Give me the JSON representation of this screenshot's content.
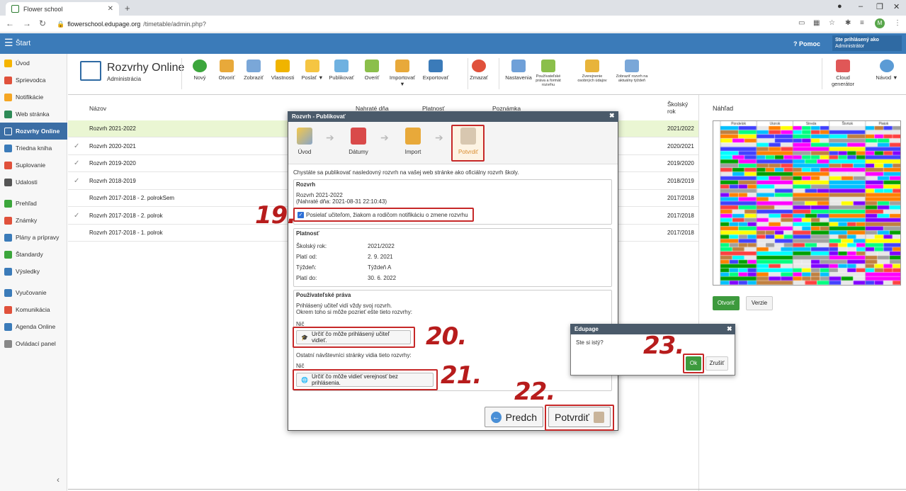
{
  "browser": {
    "tab_title": "Flower school",
    "url_domain": "flowerschool.edupage.org",
    "url_path": "/timetable/admin.php?",
    "avatar_letter": "M"
  },
  "appbar": {
    "start_label": "Štart",
    "help_label": "Pomoc",
    "login_line1": "Ste prihlásený ako",
    "login_line2": "Administrátor"
  },
  "sidebar": {
    "items": [
      {
        "label": "Úvod",
        "color": "#f5b400"
      },
      {
        "label": "Sprievodca",
        "color": "#e0513b"
      },
      {
        "label": "Notifikácie",
        "color": "#f5a623"
      },
      {
        "label": "Web stránka",
        "color": "#2e8b57"
      },
      {
        "label": "Rozvrhy Online",
        "color": "#ffffff"
      },
      {
        "label": "Triedna kniha",
        "color": "#3b7bb9"
      },
      {
        "label": "Suplovanie",
        "color": "#e0513b"
      },
      {
        "label": "Udalosti",
        "color": "#555555"
      },
      {
        "label": "Prehľad",
        "color": "#3ca63c"
      },
      {
        "label": "Známky",
        "color": "#e0513b"
      },
      {
        "label": "Plány a prípravy",
        "color": "#3b7bb9"
      },
      {
        "label": "Štandardy",
        "color": "#3ca63c"
      },
      {
        "label": "Výsledky",
        "color": "#3b7bb9"
      },
      {
        "label": "Vyučovanie",
        "color": "#3b7bb9"
      },
      {
        "label": "Komunikácia",
        "color": "#e0513b"
      },
      {
        "label": "Agenda Online",
        "color": "#3b7bb9"
      },
      {
        "label": "Ovládací panel",
        "color": "#888888"
      }
    ]
  },
  "toolbar": {
    "title": "Rozvrhy Online",
    "subtitle": "Administrácia",
    "buttons": [
      {
        "label": "Nový",
        "color": "#3ca63c"
      },
      {
        "label": "Otvoriť",
        "color": "#e8a93a"
      },
      {
        "label": "Zobraziť",
        "color": "#7aa7d8"
      },
      {
        "label": "Vlastnosti",
        "color": "#f0b400"
      },
      {
        "label": "Poslať ▼",
        "color": "#f5c542"
      },
      {
        "label": "Publikovať",
        "color": "#6fb1e0"
      },
      {
        "label": "Overiť",
        "color": "#8bbf4b"
      },
      {
        "label": "Importovať ▼",
        "color": "#e8a93a"
      },
      {
        "label": "Exportovať",
        "color": "#3b7bb9"
      },
      {
        "label": "Zmazať",
        "color": "#e0513b"
      },
      {
        "label": "Nastavenia",
        "color": "#6fa0d8"
      },
      {
        "label": "Používateľské práva a formát rozvrhu",
        "color": "#8bbf4b"
      },
      {
        "label": "Zverejnenie osobných údajov",
        "color": "#e8b43a"
      },
      {
        "label": "Zobraziť rozvrh na aktuálny týždeň",
        "color": "#7aa7d8"
      },
      {
        "label": "Cloud generátor",
        "color": "#e05757"
      },
      {
        "label": "Návod ▼",
        "color": "#5b9bd5"
      }
    ]
  },
  "table": {
    "headers": {
      "name": "Názov",
      "uploaded": "Nahraté dňa",
      "validity": "Platnosť",
      "note": "Poznámka",
      "year": "Školský rok"
    },
    "rows": [
      {
        "name": "Rozvrh 2021-2022",
        "year": "2021/2022",
        "checked": false
      },
      {
        "name": "Rozvrh 2020-2021",
        "year": "2020/2021",
        "checked": true
      },
      {
        "name": "Rozvrh 2019-2020",
        "year": "2019/2020",
        "checked": true
      },
      {
        "name": "Rozvrh 2018-2019",
        "year": "2018/2019",
        "checked": true
      },
      {
        "name": "Rozvrh 2017-2018 - 2. polrokSem",
        "year": "2017/2018",
        "checked": false
      },
      {
        "name": "Rozvrh 2017-2018 - 2. polrok",
        "year": "2017/2018",
        "checked": true
      },
      {
        "name": "Rozvrh 2017-2018 - 1. polrok",
        "year": "2017/2018",
        "checked": false
      }
    ]
  },
  "preview": {
    "title": "Náhľad",
    "days": [
      "Pondelok",
      "Utorok",
      "Streda",
      "Štvrtok",
      "Piatok"
    ],
    "open_label": "Otvoriť",
    "versions_label": "Verzie"
  },
  "dialog": {
    "title": "Rozvrh - Publikovať",
    "steps": [
      "Úvod",
      "Dátumy",
      "Import",
      "Potvrdiť"
    ],
    "intro": "Chystáte sa publikovať nasledovný rozvrh na vašej web stránke ako oficiálny rozvrh školy.",
    "rozvrh": {
      "header": "Rozvrh",
      "name": "Rozvrh 2021-2022",
      "uploaded": "(Nahraté dňa: 2021-08-31 22:10:43)",
      "notify_label": "Posielať učiteľom, žiakom a rodičom notifikáciu o zmene rozvrhu",
      "notify_checked": true
    },
    "platnost": {
      "header": "Platnosť",
      "rows": [
        {
          "key": "Školský rok:",
          "value": "2021/2022"
        },
        {
          "key": "Platí od:",
          "value": "2. 9. 2021"
        },
        {
          "key": "Týždeň:",
          "value": "Týždeň A"
        },
        {
          "key": "Platí do:",
          "value": "30. 6. 2022"
        }
      ]
    },
    "rights": {
      "header": "Používateľské práva",
      "line1": "Prihlásený učiteľ vidí vždy svoj rozvrh.",
      "line2": "Okrem toho si môže pozrieť ešte tieto rozvrhy:",
      "teacher_value": "Nič",
      "teacher_btn": "Určiť čo môže prihlásený učiteľ vidieť.",
      "public_line": "Ostatní návštevníci stránky vidia tieto rozvrhy:",
      "public_value": "Nič",
      "public_btn": "Určiť čo môže vidieť verejnosť bez prihlásenia."
    },
    "prev_label": "Predch",
    "confirm_label": "Potvrdiť"
  },
  "confirm": {
    "title": "Edupage",
    "question": "Ste si istý?",
    "ok": "Ok",
    "cancel": "Zrušiť"
  },
  "annotations": [
    "19.",
    "20.",
    "21.",
    "22.",
    "23."
  ]
}
